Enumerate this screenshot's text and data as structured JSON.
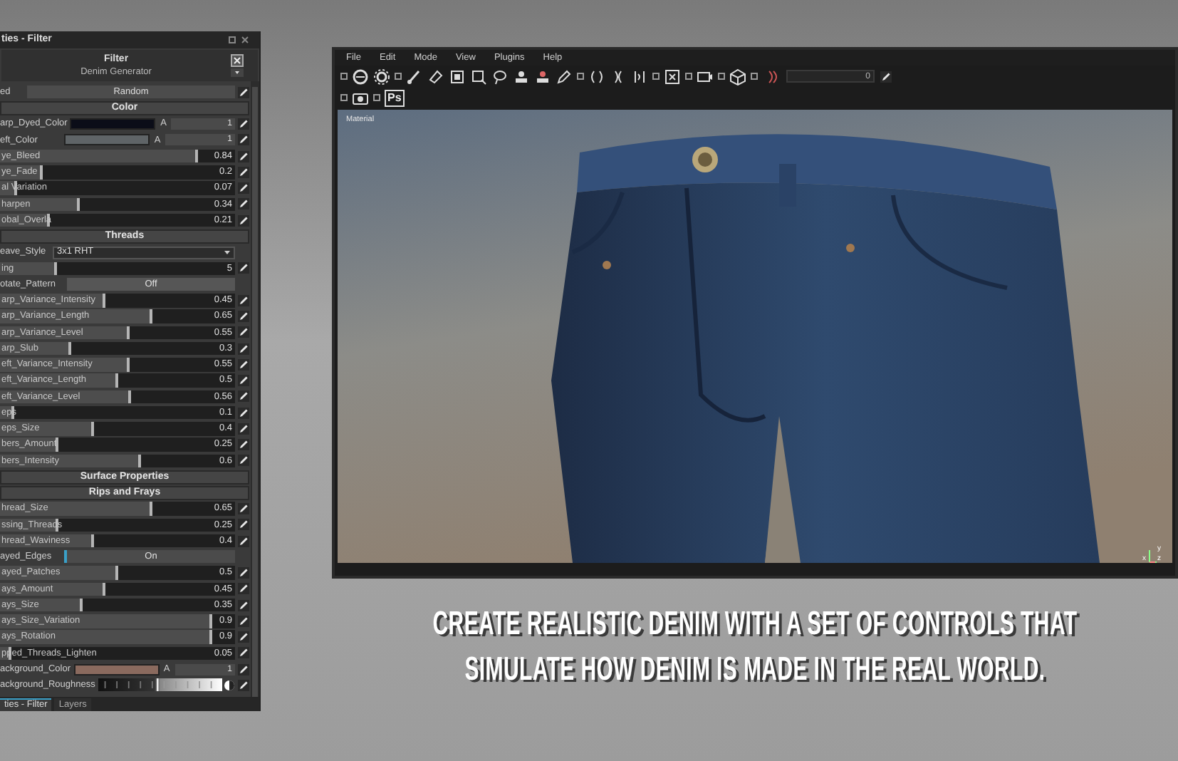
{
  "panel": {
    "title": "ties - Filter",
    "header": {
      "title": "Filter",
      "subtitle": "Denim Generator"
    },
    "rows": [
      {
        "kind": "button",
        "label": "ed",
        "value": "Random"
      },
      {
        "kind": "section",
        "label": "Color"
      },
      {
        "kind": "color",
        "label": "arp_Dyed_Color",
        "color": "#0b0d18",
        "alpha_label": "A",
        "alpha": "1"
      },
      {
        "kind": "color",
        "label": "eft_Color",
        "color": "#5f6467",
        "alpha_label": "A",
        "alpha": "1"
      },
      {
        "kind": "slider",
        "label": "ye_Bleed",
        "level": 0.84,
        "value": "0.84"
      },
      {
        "kind": "slider",
        "label": "ye_Fade",
        "level": 0.18,
        "value": "0.2"
      },
      {
        "kind": "slider",
        "label": "al Variation",
        "level": 0.07,
        "value": "0.07"
      },
      {
        "kind": "slider",
        "label": "harpen",
        "level": 0.34,
        "value": "0.34"
      },
      {
        "kind": "slider",
        "label": "obal_Overla",
        "level": 0.21,
        "value": "0.21"
      },
      {
        "kind": "section",
        "label": "Threads"
      },
      {
        "kind": "dropdown",
        "label": "eave_Style",
        "value": "3x1 RHT"
      },
      {
        "kind": "slider",
        "label": "ing",
        "level": 0.24,
        "value": "5"
      },
      {
        "kind": "toggle",
        "label": "otate_Pattern",
        "value": "Off",
        "on": false
      },
      {
        "kind": "slider",
        "label": "arp_Variance_Intensity",
        "level": 0.45,
        "value": "0.45"
      },
      {
        "kind": "slider",
        "label": "arp_Variance_Length",
        "level": 0.65,
        "value": "0.65"
      },
      {
        "kind": "slider",
        "label": "arp_Variance_Level",
        "level": 0.55,
        "value": "0.55"
      },
      {
        "kind": "slider",
        "label": "arp_Slub",
        "level": 0.3,
        "value": "0.3"
      },
      {
        "kind": "slider",
        "label": "eft_Variance_Intensity",
        "level": 0.55,
        "value": "0.55"
      },
      {
        "kind": "slider",
        "label": "eft_Variance_Length",
        "level": 0.5,
        "value": "0.5"
      },
      {
        "kind": "slider",
        "label": "eft_Variance_Level",
        "level": 0.56,
        "value": "0.56"
      },
      {
        "kind": "slider",
        "label": "eps",
        "level": 0.06,
        "value": "0.1"
      },
      {
        "kind": "slider",
        "label": "eps_Size",
        "level": 0.4,
        "value": "0.4"
      },
      {
        "kind": "slider",
        "label": "bers_Amount",
        "level": 0.25,
        "value": "0.25"
      },
      {
        "kind": "slider",
        "label": "bers_Intensity",
        "level": 0.6,
        "value": "0.6"
      },
      {
        "kind": "section",
        "label": "Surface Properties"
      },
      {
        "kind": "section",
        "label": "Rips and Frays"
      },
      {
        "kind": "slider",
        "label": "hread_Size",
        "level": 0.65,
        "value": "0.65"
      },
      {
        "kind": "slider",
        "label": "ssing_Threads",
        "level": 0.25,
        "value": "0.25"
      },
      {
        "kind": "slider",
        "label": "hread_Waviness",
        "level": 0.4,
        "value": "0.4"
      },
      {
        "kind": "toggle",
        "label": "ayed_Edges",
        "value": "On",
        "on": true
      },
      {
        "kind": "slider",
        "label": "ayed_Patches",
        "level": 0.5,
        "value": "0.5"
      },
      {
        "kind": "slider",
        "label": "ays_Amount",
        "level": 0.45,
        "value": "0.45"
      },
      {
        "kind": "slider",
        "label": "ays_Size",
        "level": 0.35,
        "value": "0.35"
      },
      {
        "kind": "slider",
        "label": "ays_Size_Variation",
        "level": 0.9,
        "value": "0.9"
      },
      {
        "kind": "slider",
        "label": "ays_Rotation",
        "level": 0.9,
        "value": "0.9"
      },
      {
        "kind": "slider",
        "label": "pped_Threads_Lighten",
        "level": 0.05,
        "value": "0.05"
      },
      {
        "kind": "color",
        "label": "ackground_Color",
        "color": "#8a6a5e",
        "alpha_label": "A",
        "alpha": "1"
      },
      {
        "kind": "gradient",
        "label": "ackground_Roughness"
      }
    ],
    "tabs": [
      {
        "label": "ties - Filter",
        "selected": true
      },
      {
        "label": "Layers",
        "selected": false
      }
    ]
  },
  "viewer": {
    "menu": [
      "File",
      "Edit",
      "Mode",
      "View",
      "Plugins",
      "Help"
    ],
    "toolbar_value": "0",
    "ps_badge": "Ps",
    "viewport": {
      "label": "Material",
      "kind": "picture"
    },
    "axes": [
      "y",
      "x",
      "z"
    ]
  },
  "caption": [
    "CREATE REALISTIC DENIM WITH A SET OF CONTROLS THAT",
    "SIMULATE HOW DENIM IS MADE IN THE REAL WORLD."
  ]
}
